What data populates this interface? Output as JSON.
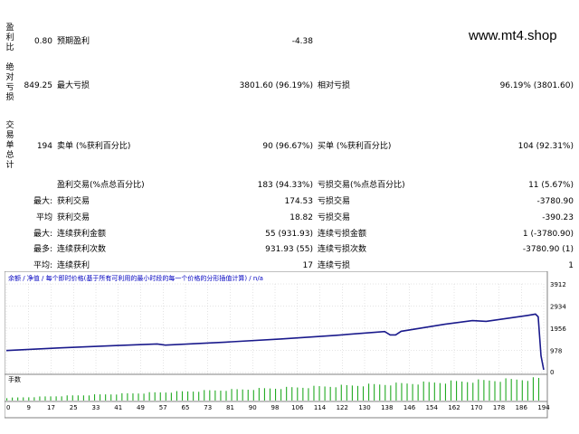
{
  "watermark": "www.mt4.shop",
  "side_labels": {
    "profit_factor": "盈利比",
    "absolute_drawdown": "绝对亏损",
    "total_trades": "交易单总计"
  },
  "stats": {
    "profit_factor_value": "0.80",
    "expected_payoff_label": "预期盈利",
    "expected_payoff_value": "-4.38",
    "absolute_drawdown_value": "849.25",
    "maximal_drawdown_label": "最大亏损",
    "maximal_drawdown_value": "3801.60 (96.19%)",
    "relative_drawdown_label": "相对亏损",
    "relative_drawdown_value": "96.19% (3801.60)",
    "total_trades_value": "194",
    "short_label": "卖单 (%获利百分比)",
    "short_value": "90 (96.67%)",
    "long_label": "买单 (%获利百分比)",
    "long_value": "104 (92.31%)",
    "profit_trades_label": "盈利交易(%点总百分比)",
    "profit_trades_value": "183 (94.33%)",
    "loss_trades_label": "亏损交易(%点总百分比)",
    "loss_trades_value": "11 (5.67%)"
  },
  "rows": [
    {
      "prefix": "最大:",
      "label1": "获利交易",
      "value1": "174.53",
      "label2": "亏损交易",
      "value2": "-3780.90"
    },
    {
      "prefix": "平均",
      "label1": "获利交易",
      "value1": "18.82",
      "label2": "亏损交易",
      "value2": "-390.23"
    },
    {
      "prefix": "最大:",
      "label1": "连续获利金额",
      "value1": "55 (931.93)",
      "label2": "连续亏损金额",
      "value2": "1 (-3780.90)"
    },
    {
      "prefix": "最多:",
      "label1": "连续获利次数",
      "value1": "931.93 (55)",
      "label2": "连续亏损次数",
      "value2": "-3780.90 (1)"
    },
    {
      "prefix": "平均:",
      "label1": "连续获利",
      "value1": "17",
      "label2": "连续亏损",
      "value2": "1"
    }
  ],
  "chart_header": "余额 / 净值 / 每个即时价格(基于所有可利用的最小时段的每一个价格的分形插值计算) / n/a",
  "lots_label": "手数",
  "colors": {
    "balance_line": "#1a1a8c",
    "volume_bar": "#22aa22",
    "grid": "#c8c8c8",
    "header_blue": "#0000c0",
    "header_green": "#008000"
  },
  "chart_data": {
    "type": "line",
    "xlabel": "",
    "ylabel": "",
    "x_ticks": [
      "0",
      "9",
      "17",
      "25",
      "33",
      "41",
      "49",
      "57",
      "65",
      "73",
      "81",
      "90",
      "98",
      "106",
      "114",
      "122",
      "130",
      "138",
      "146",
      "154",
      "162",
      "170",
      "178",
      "186",
      "194"
    ],
    "y_ticks": [
      "3912",
      "2934",
      "1956",
      "978",
      "0"
    ],
    "ylim": [
      0,
      3912
    ],
    "xlim": [
      0,
      196
    ],
    "grid": true,
    "series": [
      {
        "x": [
          0,
          20,
          40,
          55,
          58,
          80,
          100,
          120,
          138,
          140,
          142,
          144,
          160,
          170,
          175,
          190,
          193,
          194,
          195,
          196
        ],
        "y": [
          970,
          1090,
          1190,
          1260,
          1210,
          1340,
          1480,
          1640,
          1810,
          1660,
          1660,
          1820,
          2130,
          2290,
          2260,
          2520,
          2580,
          2460,
          740,
          120
        ]
      }
    ],
    "volume": {
      "name": "手数",
      "x_range": [
        0,
        194
      ],
      "values_start": 0.12,
      "values_end": 1.0
    }
  }
}
